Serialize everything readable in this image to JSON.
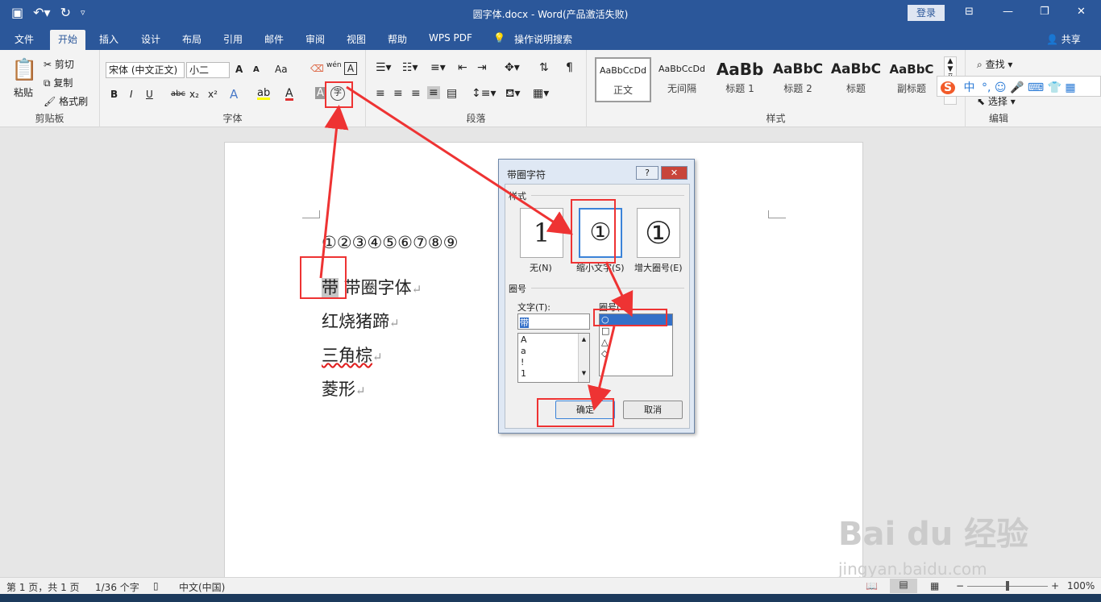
{
  "window": {
    "title": "圆字体.docx  -  Word(产品激活失败)",
    "login_label": "登录",
    "qat_icons": [
      "save-icon",
      "undo-icon",
      "redo-icon",
      "customize-icon"
    ]
  },
  "tabs": [
    "文件",
    "开始",
    "插入",
    "设计",
    "布局",
    "引用",
    "邮件",
    "审阅",
    "视图",
    "帮助",
    "WPS PDF"
  ],
  "active_tab": "开始",
  "tell_me": "操作说明搜索",
  "share_label": "共享",
  "ribbon": {
    "clipboard": {
      "paste": "粘贴",
      "cut": "剪切",
      "copy": "复制",
      "format_painter": "格式刷",
      "group": "剪贴板"
    },
    "font": {
      "font_name": "宋体 (中文正文)",
      "font_size": "小二",
      "group": "字体",
      "bold": "B",
      "italic": "I",
      "underline": "U",
      "strike": "abc",
      "sub": "x₂",
      "sup": "x²",
      "grow": "A",
      "shrink": "A",
      "case": "Aa",
      "phonetic": "wén",
      "border_char": "A",
      "highlight_color": "#ffff00",
      "font_color": "#e03030",
      "enclose_char": "字"
    },
    "paragraph": {
      "group": "段落"
    },
    "styles": {
      "group": "样式",
      "items": [
        {
          "preview": "AaBbCcDd",
          "name": "正文"
        },
        {
          "preview": "AaBbCcDd",
          "name": "无间隔"
        },
        {
          "preview": "AaBb",
          "name": "标题 1"
        },
        {
          "preview": "AaBbC",
          "name": "标题 2"
        },
        {
          "preview": "AaBbC",
          "name": "标题"
        },
        {
          "preview": "AaBbC",
          "name": "副标题"
        }
      ]
    },
    "editing": {
      "find": "查找",
      "select": "选择",
      "group": "编辑"
    },
    "ime": {
      "logo": "S",
      "lang": "中"
    }
  },
  "document": {
    "circled_numbers": "①②③④⑤⑥⑦⑧⑨",
    "line1_selected": "带",
    "line1_rest": " 带圈字体",
    "line2": "红烧猪蹄",
    "line3": "三角棕",
    "line4": "菱形",
    "para_mark": "↵"
  },
  "dialog": {
    "title": "带圈字符",
    "help": "?",
    "close": "✕",
    "style_label": "样式",
    "options": [
      {
        "glyph": "1",
        "label": "无(N)"
      },
      {
        "glyph": "①",
        "label": "缩小文字(S)"
      },
      {
        "glyph": "①",
        "label": "增大圈号(E)"
      }
    ],
    "selected_option": "缩小文字(S)",
    "enclosure_label": "圈号",
    "text_label": "文字(T):",
    "text_value": "带",
    "text_list": [
      "A",
      "a",
      "!",
      "1"
    ],
    "enclosure_list_label": "圈号(H):",
    "enclosure_list": [
      "○",
      "□",
      "△",
      "◇"
    ],
    "selected_enclosure": "○",
    "ok": "确定",
    "cancel": "取消"
  },
  "statusbar": {
    "page": "第 1 页，共 1 页",
    "words": "1/36 个字",
    "language": "中文(中国)",
    "zoom": "100%",
    "zoom_minus": "−",
    "zoom_plus": "+"
  },
  "watermark": {
    "brand": "Bai du 经验",
    "url": "jingyan.baidu.com"
  },
  "annotation_color": "#ee3333"
}
